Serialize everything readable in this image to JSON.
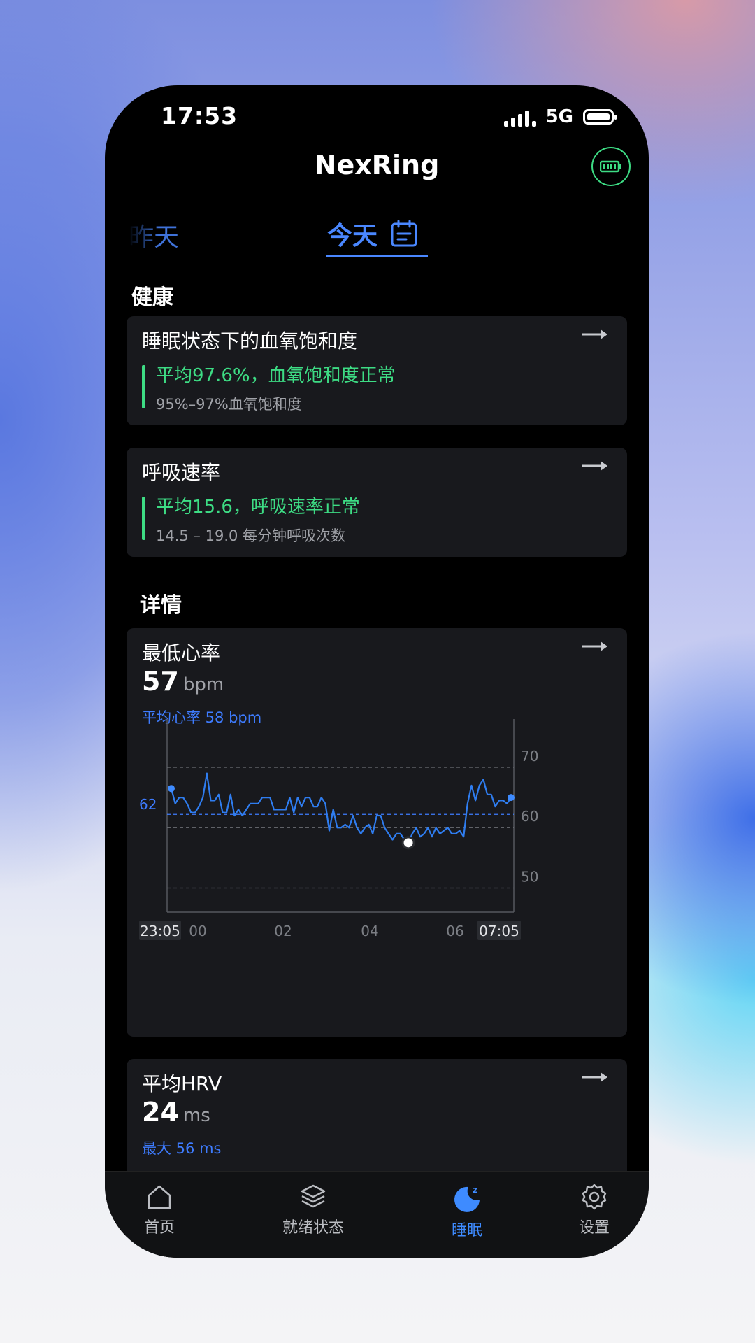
{
  "status_bar": {
    "time": "17:53",
    "network": "5G"
  },
  "app": {
    "title": "NexRing",
    "device_icon": "battery-device-icon",
    "accent": "#3e8bff",
    "ok_color": "#3ddc84"
  },
  "date_tabs": {
    "previous": "昨天",
    "current": "今天"
  },
  "health": {
    "section_title": "健康",
    "spo2": {
      "title": "睡眠状态下的血氧饱和度",
      "status": "平均97.6%，血氧饱和度正常",
      "range": "95%–97%血氧饱和度"
    },
    "respiration": {
      "title": "呼吸速率",
      "status": "平均15.6，呼吸速率正常",
      "range": "14.5 – 19.0 每分钟呼吸次数"
    }
  },
  "details": {
    "section_title": "详情",
    "lowest_hr": {
      "title": "最低心率",
      "value": "57",
      "unit": "bpm",
      "average": "平均心率 58 bpm"
    },
    "hrv": {
      "title": "平均HRV",
      "value": "24",
      "unit": "ms",
      "max": "最大 56 ms"
    }
  },
  "chart_data": {
    "type": "line",
    "title": "",
    "x_start_label": "23:05",
    "x_end_label": "07:05",
    "x_ticks": [
      "00",
      "02",
      "04",
      "06"
    ],
    "y_ticks": [
      70,
      60,
      50
    ],
    "ylim": [
      44,
      76
    ],
    "reference_line_label": "62",
    "reference_lines": [
      68,
      60.2,
      58,
      48
    ],
    "series": [
      {
        "values": [
          64.5,
          62,
          63,
          63,
          62,
          60.5,
          60.5,
          61.5,
          63,
          67,
          62.5,
          62.5,
          63.5,
          60.5,
          60.5,
          63.5,
          60,
          61,
          60,
          61,
          62,
          62,
          62,
          63,
          63,
          63,
          61,
          61,
          61,
          61,
          63,
          60.5,
          63,
          61.5,
          63,
          63,
          61.5,
          61.5,
          63,
          62,
          57.5,
          61,
          58,
          58,
          58.5,
          58,
          60,
          58,
          57,
          58,
          58.5,
          57,
          60,
          60,
          58,
          57,
          56,
          57,
          57,
          56,
          55.5,
          57,
          58,
          56.5,
          57,
          58,
          56.5,
          58,
          57,
          57.5,
          58,
          57,
          57,
          57.5,
          56.5,
          62,
          65,
          62.5,
          65,
          66,
          63.5,
          63.5,
          61.5,
          62.5,
          62.5,
          62,
          63
        ],
        "start_value": 64.5,
        "end_value": 62,
        "minimum_value": 55.5
      }
    ]
  },
  "bottom_nav": [
    {
      "label": "首页",
      "icon": "home-icon"
    },
    {
      "label": "就绪状态",
      "icon": "layers-icon"
    },
    {
      "label": "睡眠",
      "icon": "sleep-moon-icon"
    },
    {
      "label": "设置",
      "icon": "gear-icon"
    }
  ]
}
